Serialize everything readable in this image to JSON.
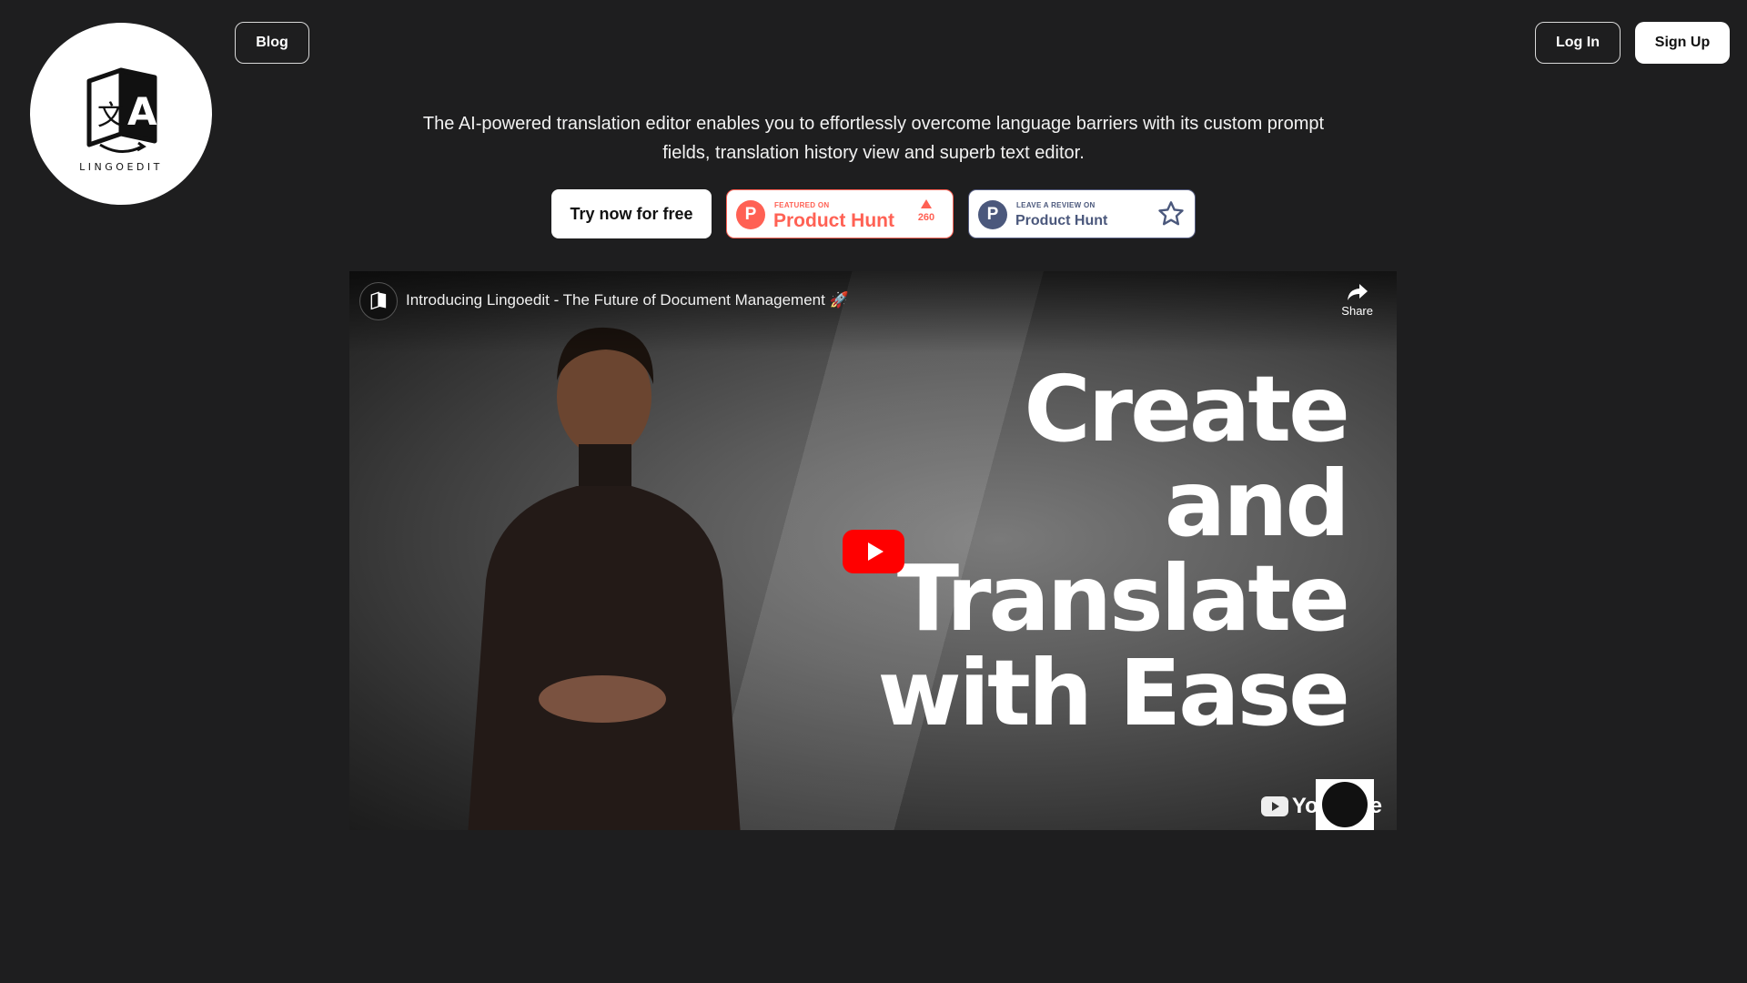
{
  "brand": {
    "name": "LINGOEDIT"
  },
  "nav": {
    "blog_label": "Blog",
    "login_label": "Log In",
    "signup_label": "Sign Up"
  },
  "hero": {
    "tagline": "The AI-powered translation editor enables you to effortlessly overcome language barriers with its custom prompt fields, translation history view and superb text editor.",
    "cta_label": "Try now for free"
  },
  "product_hunt_featured": {
    "small_label": "FEATURED ON",
    "name": "Product Hunt",
    "votes": "260"
  },
  "product_hunt_review": {
    "small_label": "LEAVE A REVIEW ON",
    "name": "Product Hunt"
  },
  "video": {
    "title": "Introducing Lingoedit - The Future of Document Management 🚀",
    "share_label": "Share",
    "headline_lines": [
      "Create",
      "and",
      "Translate",
      "with Ease"
    ],
    "platform_label": "YouTube"
  },
  "colors": {
    "background": "#1e1e1f",
    "product_hunt_orange": "#ff6154",
    "product_hunt_navy": "#4b587c",
    "youtube_red": "#ff0000"
  },
  "icons": {
    "logo": "translate-book-icon",
    "share": "share-arrow-icon",
    "play": "play-icon",
    "star": "star-icon"
  }
}
